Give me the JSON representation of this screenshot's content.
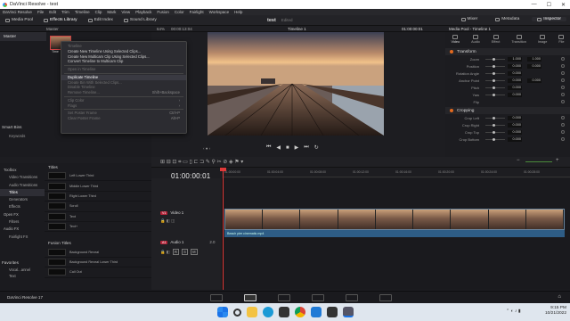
{
  "window": {
    "title": "DaVinci Resolve - test",
    "controls": [
      "—",
      "☐",
      "✕"
    ]
  },
  "menubar": [
    "DaVinci Resolve",
    "File",
    "Edit",
    "Trim",
    "Timeline",
    "Clip",
    "Mark",
    "View",
    "Playback",
    "Fusion",
    "Color",
    "Fairlight",
    "Workspace",
    "Help"
  ],
  "toolbar": {
    "left": [
      {
        "label": "Media Pool",
        "icon": "media-pool-icon"
      },
      {
        "label": "Effects Library",
        "icon": "effects-library-icon",
        "active": true
      },
      {
        "label": "Edit Index",
        "icon": "edit-index-icon"
      },
      {
        "label": "Sound Library",
        "icon": "sound-library-icon"
      }
    ],
    "project": "test",
    "project_status": "Edited",
    "right": [
      {
        "label": "Mixer",
        "icon": "mixer-icon"
      },
      {
        "label": "Metadata",
        "icon": "metadata-icon"
      },
      {
        "label": "Inspector",
        "icon": "inspector-icon",
        "active": true
      }
    ]
  },
  "subheader": {
    "pool": "Master",
    "zoom": "64%",
    "src_tc": "00:00:13:04",
    "timeline": "Timeline 1",
    "tc": "01:00:00:01",
    "inspector_title": "Media Pool - Timeline 1"
  },
  "media_pool": {
    "bin": "Master",
    "smart_bins": "Smart Bins",
    "keywords": "Keywords",
    "clip_caption": "Time"
  },
  "context_menu": [
    {
      "label": "Timeline",
      "enabled": false
    },
    {
      "label": "Create New Timeline Using Selected Clips...",
      "enabled": true
    },
    {
      "label": "Create New Multicam Clip Using Selected Clips...",
      "enabled": true
    },
    {
      "label": "Convert Timeline to Multicam Clip",
      "enabled": true
    },
    {
      "sep": true
    },
    {
      "label": "Open in Timeline",
      "enabled": false
    },
    {
      "sep": true
    },
    {
      "label": "Duplicate Timeline",
      "enabled": true,
      "highlight": true
    },
    {
      "label": "Create Bin With Selected Clips...",
      "enabled": false
    },
    {
      "label": "Disable Timeline",
      "enabled": false
    },
    {
      "label": "Remove Timeline...",
      "enabled": false,
      "shortcut": "Shift+Backspace"
    },
    {
      "sep": true
    },
    {
      "label": "Clip Color",
      "enabled": false,
      "shortcut": "›"
    },
    {
      "label": "Flags",
      "enabled": false,
      "shortcut": "›"
    },
    {
      "sep": true
    },
    {
      "label": "Set Poster Frame",
      "enabled": false,
      "shortcut": "Ctrl+P"
    },
    {
      "label": "Clear Poster Frame",
      "enabled": false,
      "shortcut": "Alt+P"
    }
  ],
  "viewer": {
    "title": "Timeline 1",
    "tc": "01:00:00:01",
    "page_indicator": "‹ ● ›"
  },
  "transport": [
    "⏮",
    "◀",
    "■",
    "▶",
    "⏭",
    "↻"
  ],
  "inspector": {
    "tabs": [
      "Video",
      "Audio",
      "Effect",
      "Transition",
      "Image",
      "File"
    ],
    "transform": {
      "title": "Transform",
      "rows": [
        {
          "label": "Zoom",
          "x": "1.000",
          "y": "1.000"
        },
        {
          "label": "Position",
          "x": "0.000",
          "y": "0.000"
        },
        {
          "label": "Rotation Angle",
          "x": "0.000"
        },
        {
          "label": "Anchor Point",
          "x": "0.000",
          "y": "0.000"
        },
        {
          "label": "Pitch",
          "x": "0.000"
        },
        {
          "label": "Yaw",
          "x": "0.000"
        },
        {
          "label": "Flip",
          "x": ""
        }
      ]
    },
    "cropping": {
      "title": "Cropping",
      "rows": [
        {
          "label": "Crop Left",
          "x": "0.000"
        },
        {
          "label": "Crop Right",
          "x": "0.000"
        },
        {
          "label": "Crop Top",
          "x": "0.000"
        },
        {
          "label": "Crop Bottom",
          "x": "0.000"
        }
      ]
    }
  },
  "effects": {
    "tree": [
      {
        "label": "Toolbox",
        "top": true
      },
      {
        "label": "Video Transitions"
      },
      {
        "label": "Audio Transitions"
      },
      {
        "label": "Titles",
        "selected": true
      },
      {
        "label": "Generators"
      },
      {
        "label": "Effects"
      },
      {
        "label": "Open FX",
        "top": true
      },
      {
        "label": "Filters"
      },
      {
        "label": "Audio FX",
        "top": true
      },
      {
        "label": "Fairlight FX"
      }
    ],
    "favorites": "Favorites",
    "fav_items": [
      "Vocal...annel",
      "Text"
    ],
    "titles_header": "Titles",
    "titles": [
      "Left Lower Third",
      "Middle Lower Third",
      "Right Lower Third",
      "Scroll",
      "Text",
      "Text+"
    ],
    "fusion_header": "Fusion Titles",
    "fusion_titles": [
      "Background Reveal",
      "Background Reveal Lower Third",
      "Call Out"
    ]
  },
  "timeline": {
    "timecode": "01:00:00:01",
    "ruler": [
      "01:00:00:00",
      "01:00:04:00",
      "01:00:08:00",
      "01:00:12:00",
      "01:00:16:00",
      "01:00:20:00",
      "01:00:24:00",
      "01:00:28:00"
    ],
    "tracks": [
      {
        "badge": "V1",
        "name": "Video 1"
      },
      {
        "badge": "A1",
        "name": "Audio 1",
        "level": "2.0"
      }
    ],
    "audio_clip": "Beach pier cinematic.mp4"
  },
  "app": {
    "name": "DaVinci Resolve 17"
  },
  "taskbar": {
    "time": "9:15 PM",
    "date": "10/21/2022"
  }
}
